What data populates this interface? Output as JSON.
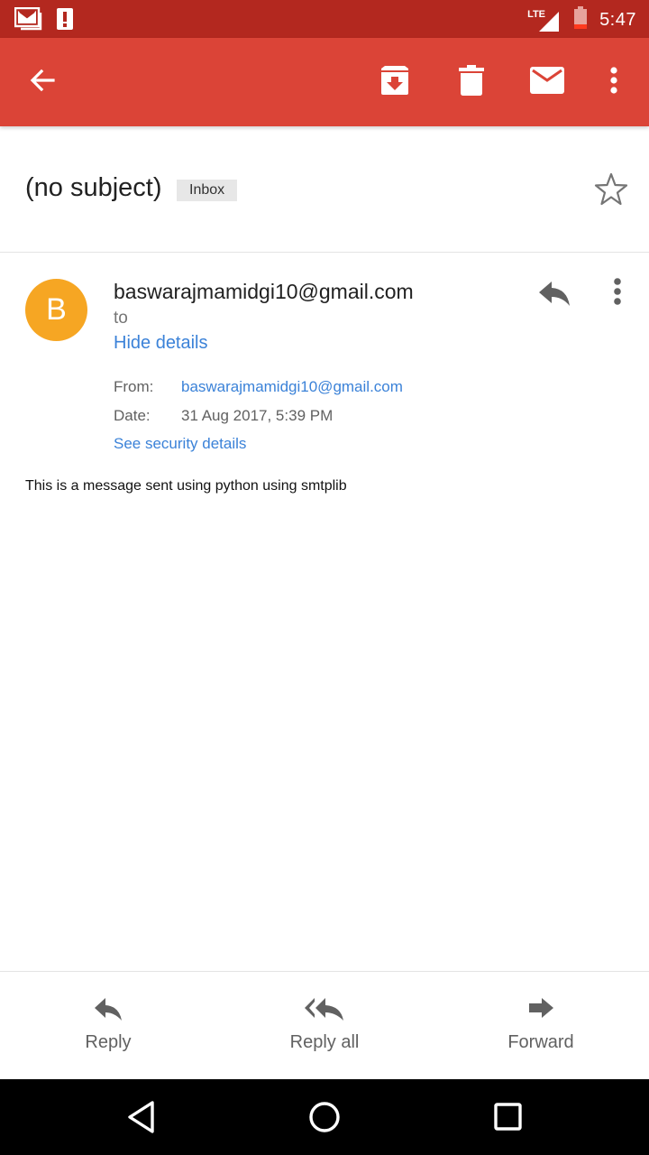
{
  "status_bar": {
    "time": "5:47",
    "network_label": "LTE",
    "icons": [
      "gmail-notification-icon",
      "alert-notification-icon",
      "lte-signal-icon",
      "battery-low-icon"
    ]
  },
  "app_bar": {
    "icons": [
      "back-arrow-icon",
      "archive-icon",
      "delete-icon",
      "mark-unread-icon",
      "more-vert-icon"
    ],
    "color": "#db4437"
  },
  "email": {
    "subject": "(no subject)",
    "label": "Inbox",
    "sender_initial": "B",
    "sender": "baswarajmamidgi10@gmail.com",
    "to_text": "to",
    "hide_details": "Hide details",
    "details": {
      "from_label": "From:",
      "from_value": "baswarajmamidgi10@gmail.com",
      "date_label": "Date:",
      "date_value": "31 Aug 2017, 5:39 PM"
    },
    "security_link": "See security details",
    "body": "This is a message sent using python using smtplib",
    "avatar_color": "#f6a623"
  },
  "actions": {
    "reply": "Reply",
    "reply_all": "Reply all",
    "forward": "Forward"
  },
  "nav": {
    "icons": [
      "back-triangle-icon",
      "home-circle-icon",
      "recents-square-icon"
    ]
  }
}
